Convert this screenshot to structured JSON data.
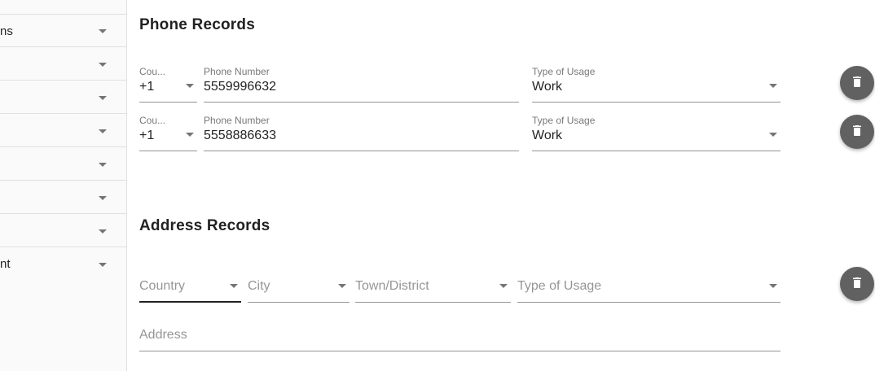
{
  "sidebar": {
    "items": [
      {
        "label": ""
      },
      {
        "label": "ns"
      },
      {
        "label": ""
      },
      {
        "label": ""
      },
      {
        "label": ""
      },
      {
        "label": ""
      },
      {
        "label": ""
      },
      {
        "label": ""
      },
      {
        "label": "nt"
      }
    ]
  },
  "phone_section": {
    "title": "Phone Records",
    "records": [
      {
        "country_label": "Country",
        "country_display": "Cou...",
        "country_value": "+1",
        "number_label": "Phone Number",
        "number_value": "5559996632",
        "usage_label": "Type of Usage",
        "usage_value": "Work"
      },
      {
        "country_label": "Country",
        "country_display": "Cou...",
        "country_value": "+1",
        "number_label": "Phone Number",
        "number_value": "5558886633",
        "usage_label": "Type of Usage",
        "usage_value": "Work"
      }
    ]
  },
  "address_section": {
    "title": "Address Records",
    "country_placeholder": "Country",
    "city_placeholder": "City",
    "district_placeholder": "Town/District",
    "usage_placeholder": "Type of Usage",
    "address_placeholder": "Address"
  },
  "icons": {
    "delete": "trash-icon",
    "dropdown": "arrow-drop-down-icon"
  },
  "colors": {
    "fab": "#616161",
    "sidebar_bg": "#fafafa"
  }
}
